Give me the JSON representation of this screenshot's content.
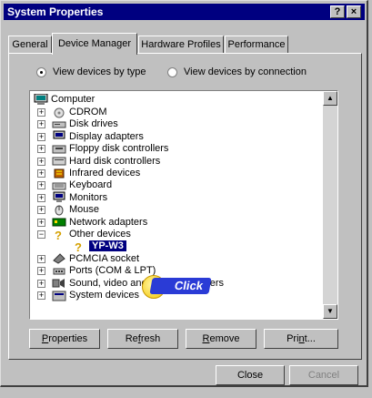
{
  "window": {
    "title": "System Properties",
    "help_btn": "?",
    "close_btn": "×"
  },
  "tabs": [
    "General",
    "Device Manager",
    "Hardware Profiles",
    "Performance"
  ],
  "view": {
    "by_type": "View devices by type",
    "by_connection": "View devices by connection",
    "selected": "by_type"
  },
  "tree": {
    "root": "Computer",
    "items": [
      {
        "label": "CDROM",
        "icon": "cdrom-icon"
      },
      {
        "label": "Disk drives",
        "icon": "disk-drive-icon"
      },
      {
        "label": "Display adapters",
        "icon": "display-adapter-icon"
      },
      {
        "label": "Floppy disk controllers",
        "icon": "floppy-controller-icon"
      },
      {
        "label": "Hard disk controllers",
        "icon": "hard-disk-controller-icon"
      },
      {
        "label": "Infrared devices",
        "icon": "infrared-icon"
      },
      {
        "label": "Keyboard",
        "icon": "keyboard-icon"
      },
      {
        "label": "Monitors",
        "icon": "monitor-icon"
      },
      {
        "label": "Mouse",
        "icon": "mouse-icon"
      },
      {
        "label": "Network adapters",
        "icon": "network-adapter-icon"
      },
      {
        "label": "Other devices",
        "icon": "question-icon"
      },
      {
        "label": "YP-W3",
        "icon": "question-icon"
      },
      {
        "label": "PCMCIA socket",
        "icon": "pcmcia-icon"
      },
      {
        "label": "Ports (COM & LPT)",
        "icon": "port-icon"
      },
      {
        "label": "Sound, video and game controllers",
        "icon": "sound-icon"
      },
      {
        "label": "System devices",
        "icon": "system-icon"
      }
    ]
  },
  "buttons": {
    "properties": "Properties",
    "refresh": "Refresh",
    "remove": "Remove",
    "print": "Print...",
    "close": "Close",
    "cancel": "Cancel"
  },
  "overlay": {
    "click_label": "Click"
  },
  "colors": {
    "title_bar": "#000080",
    "selection": "#000080",
    "click_badge": "#2a3bd6"
  }
}
